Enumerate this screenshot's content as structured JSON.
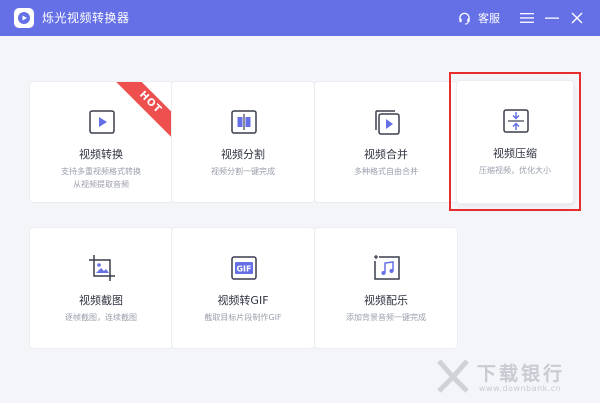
{
  "app": {
    "title": "烁光视频转换器",
    "service_label": "客服",
    "accent": "#6670e6"
  },
  "icons": {
    "logo": "app-logo-icon",
    "service": "headset-icon",
    "menu": "menu-icon",
    "minimize": "minimize-icon",
    "close": "close-icon"
  },
  "cards": [
    {
      "id": "convert",
      "title": "视频转换",
      "desc_line1": "支持多重视频格式转换",
      "desc_line2": "从视频提取音频",
      "badge": "HOT",
      "icon": "play-screen-icon"
    },
    {
      "id": "split",
      "title": "视频分割",
      "desc_line1": "视频分割一键完成",
      "desc_line2": "",
      "icon": "split-icon"
    },
    {
      "id": "merge",
      "title": "视频合并",
      "desc_line1": "多种格式自由合并",
      "desc_line2": "",
      "icon": "stack-play-icon"
    },
    {
      "id": "compress",
      "title": "视频压缩",
      "desc_line1": "压缩视频，优化大小",
      "desc_line2": "",
      "icon": "compress-icon",
      "selected": true
    },
    {
      "id": "crop",
      "title": "视频截图",
      "desc_line1": "逐帧截图，连续截图",
      "desc_line2": "",
      "icon": "crop-image-icon"
    },
    {
      "id": "gif",
      "title": "视频转GIF",
      "desc_line1": "截取目标片段制作GIF",
      "desc_line2": "",
      "icon": "gif-icon"
    },
    {
      "id": "music",
      "title": "视频配乐",
      "desc_line1": "添加背景音频一键完成",
      "desc_line2": "",
      "icon": "music-note-icon"
    }
  ],
  "highlight_color": "#e52d2d",
  "watermark": {
    "text": "下载银行",
    "url": "www.downbank.cn"
  }
}
